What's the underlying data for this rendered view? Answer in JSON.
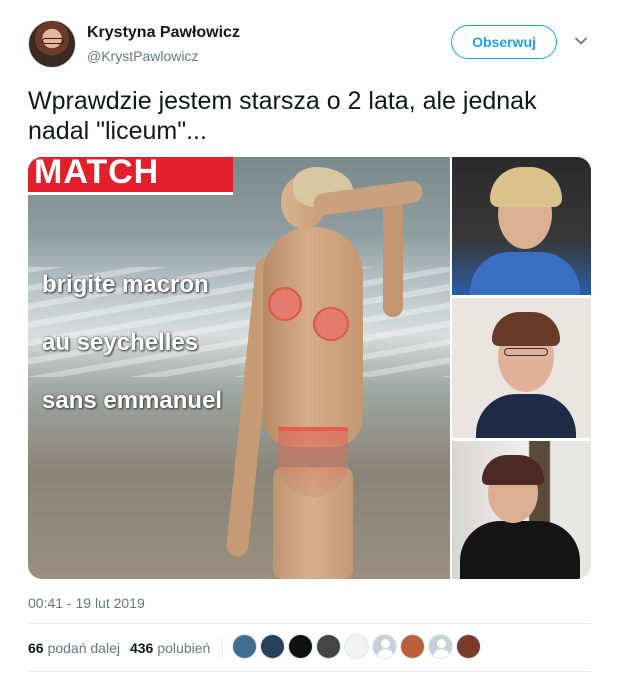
{
  "user": {
    "name": "Krystyna Pawłowicz",
    "handle": "@KrystPawlowicz",
    "avatar_icon": "profile-photo"
  },
  "follow_button": {
    "label": "Obserwuj",
    "color": "#1da1f2"
  },
  "menu_icon": "chevron-down-icon",
  "tweet": {
    "text": "Wprawdzie jestem starsza o 2 lata, ale jednak nadal \"liceum\"..."
  },
  "media": {
    "main_image": {
      "magazine_logo": "MATCH",
      "caption_lines": [
        "brigite macron",
        "au seychelles",
        "sans emmanuel"
      ]
    },
    "side_images": [
      "photo-woman-blonde",
      "photo-woman-glasses",
      "photo-woman-black-dress"
    ]
  },
  "timestamp": "00:41 - 19 lut 2019",
  "stats": {
    "retweets_count": "66",
    "retweets_label": "podań dalej",
    "likes_count": "436",
    "likes_label": "polubień"
  },
  "likers": [
    {
      "icon": "liker-avatar",
      "color": "#3f6e8e"
    },
    {
      "icon": "liker-avatar",
      "color": "#2a3f5a"
    },
    {
      "icon": "liker-avatar",
      "color": "#111111"
    },
    {
      "icon": "liker-avatar",
      "color": "#444444"
    },
    {
      "icon": "liker-avatar",
      "color": "#f2f2f2"
    },
    {
      "icon": "default-avatar",
      "color": "#c7d0d8"
    },
    {
      "icon": "liker-avatar",
      "color": "#b9603d"
    },
    {
      "icon": "default-avatar",
      "color": "#c7d0d8"
    },
    {
      "icon": "liker-avatar",
      "color": "#7a3a2c"
    }
  ]
}
